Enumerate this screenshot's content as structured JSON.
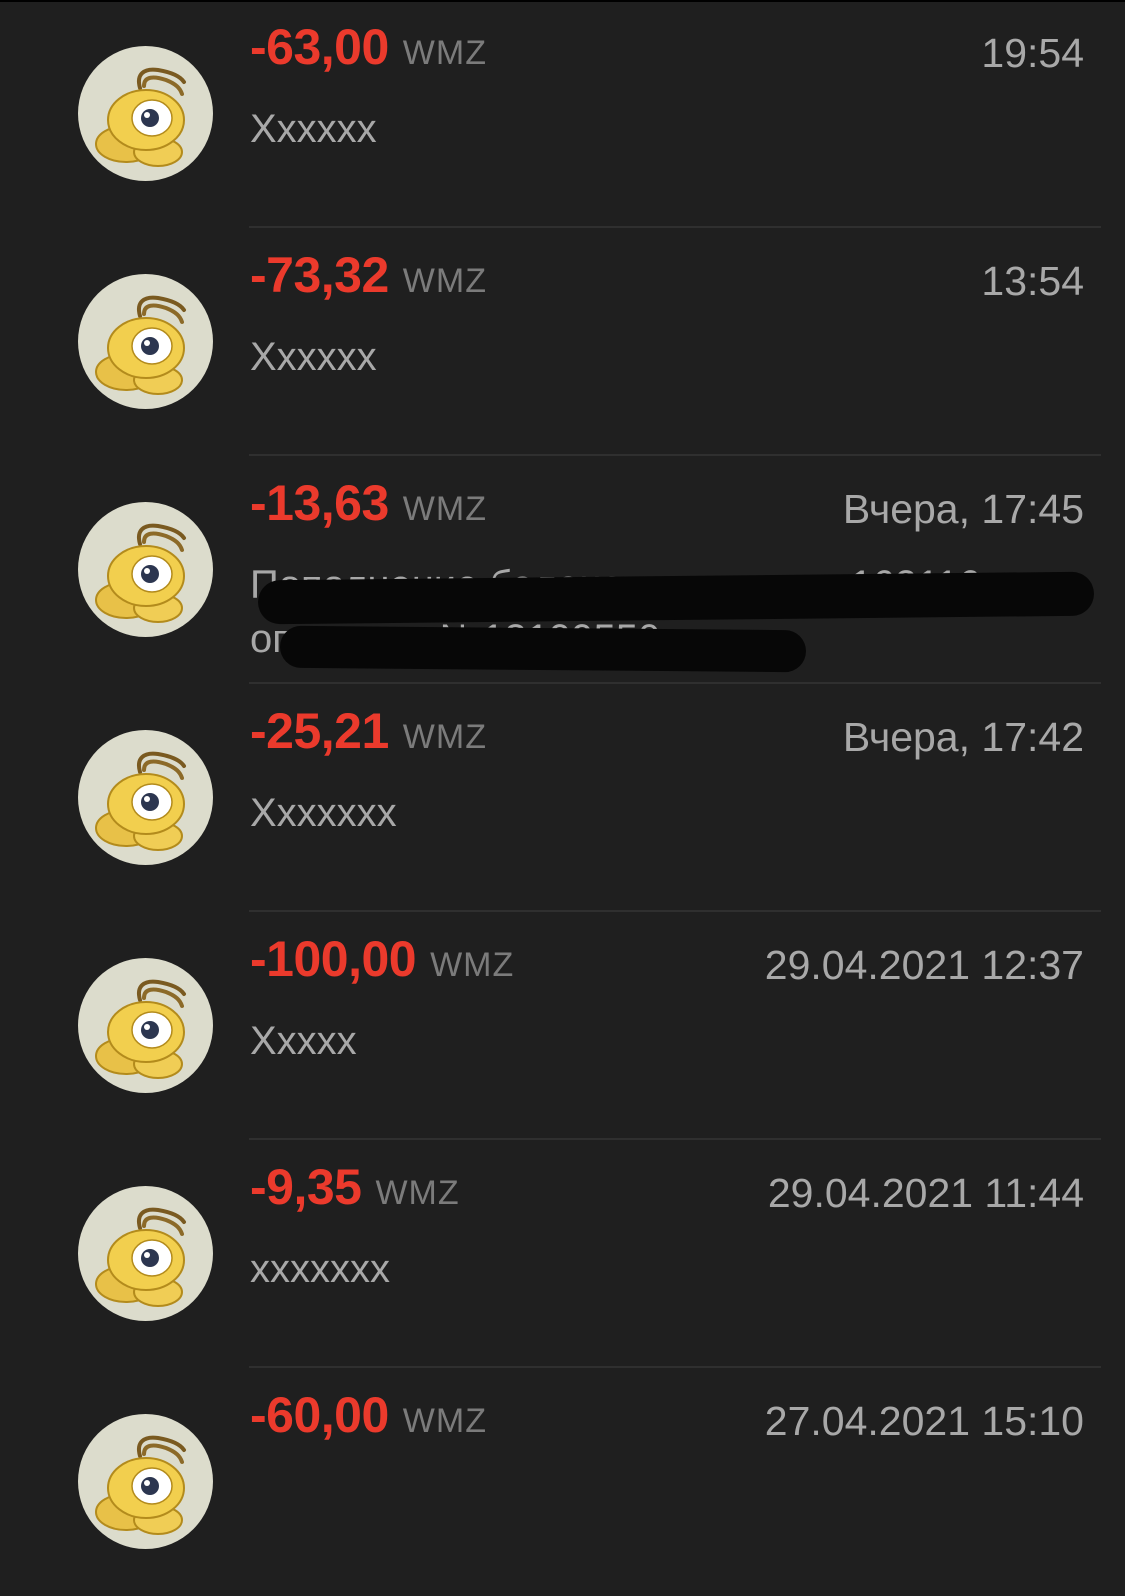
{
  "transactions": [
    {
      "amount": "-63,00",
      "currency": "WMZ",
      "time": "19:54",
      "description": "Xxxxxx",
      "redacted": false
    },
    {
      "amount": "-73,32",
      "currency": "WMZ",
      "time": "13:54",
      "description": "Xxxxxx",
      "redacted": false
    },
    {
      "amount": "-13,63",
      "currency": "WMZ",
      "time": "Вчера, 17:45",
      "description": "Пополнение баланса аккаунта а162116 по операции №13199550",
      "redacted": true
    },
    {
      "amount": "-25,21",
      "currency": "WMZ",
      "time": "Вчера, 17:42",
      "description": "Xxxxxxx",
      "redacted": false
    },
    {
      "amount": "-100,00",
      "currency": "WMZ",
      "time": "29.04.2021 12:37",
      "description": "Xxxxx",
      "redacted": false
    },
    {
      "amount": "-9,35",
      "currency": "WMZ",
      "time": "29.04.2021 11:44",
      "description": "xxxxxxx",
      "redacted": false
    },
    {
      "amount": "-60,00",
      "currency": "WMZ",
      "time": "27.04.2021 15:10",
      "description": "",
      "redacted": false
    }
  ],
  "icons": {
    "avatar": "webmoney-bug-icon"
  },
  "colors": {
    "background": "#1f1f1f",
    "amount": "#eb3a2c",
    "currency": "#7b7b7b",
    "text": "#a8a8a8"
  }
}
